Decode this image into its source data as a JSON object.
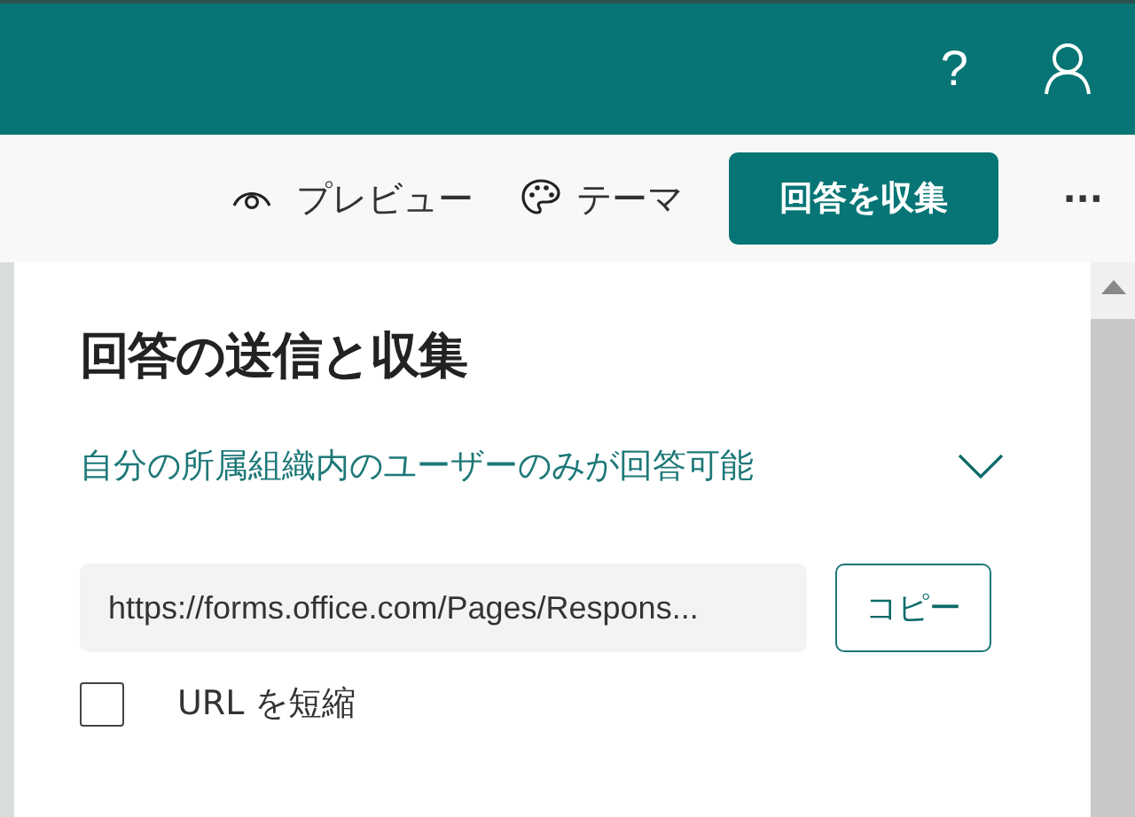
{
  "header": {
    "help": "?"
  },
  "toolbar": {
    "preview": "プレビュー",
    "theme": "テーマ",
    "collect": "回答を収集",
    "more": "···"
  },
  "panel": {
    "title": "回答の送信と収集",
    "audience": {
      "value": "自分の所属組織内のユーザーのみが回答可能"
    },
    "link": {
      "value": "https://forms.office.com/Pages/Respons...",
      "copy": "コピー"
    },
    "shorten": {
      "label": "URL を短縮",
      "checked": false
    }
  }
}
